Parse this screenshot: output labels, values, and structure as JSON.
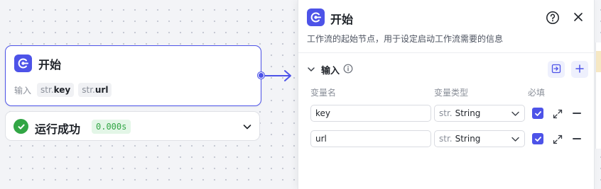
{
  "canvas": {
    "start_node": {
      "title": "开始",
      "inputs_label": "输入",
      "inputs": [
        {
          "type_prefix": "str.",
          "name": "key"
        },
        {
          "type_prefix": "str.",
          "name": "url"
        }
      ]
    },
    "run_status": {
      "text": "运行成功",
      "duration": "0.000s"
    }
  },
  "panel": {
    "title": "开始",
    "description": "工作流的起始节点，用于设定启动工作流需要的信息",
    "section": {
      "title": "输入"
    },
    "columns": {
      "name": "变量名",
      "type": "变量类型",
      "required": "必填"
    },
    "rows": [
      {
        "name": "key",
        "type_prefix": "str.",
        "type": "String",
        "required": true
      },
      {
        "name": "url",
        "type_prefix": "str.",
        "type": "String",
        "required": true
      }
    ]
  },
  "colors": {
    "accent": "#4d53e8",
    "success": "#32a645",
    "success_bg": "#e3f6e7"
  }
}
